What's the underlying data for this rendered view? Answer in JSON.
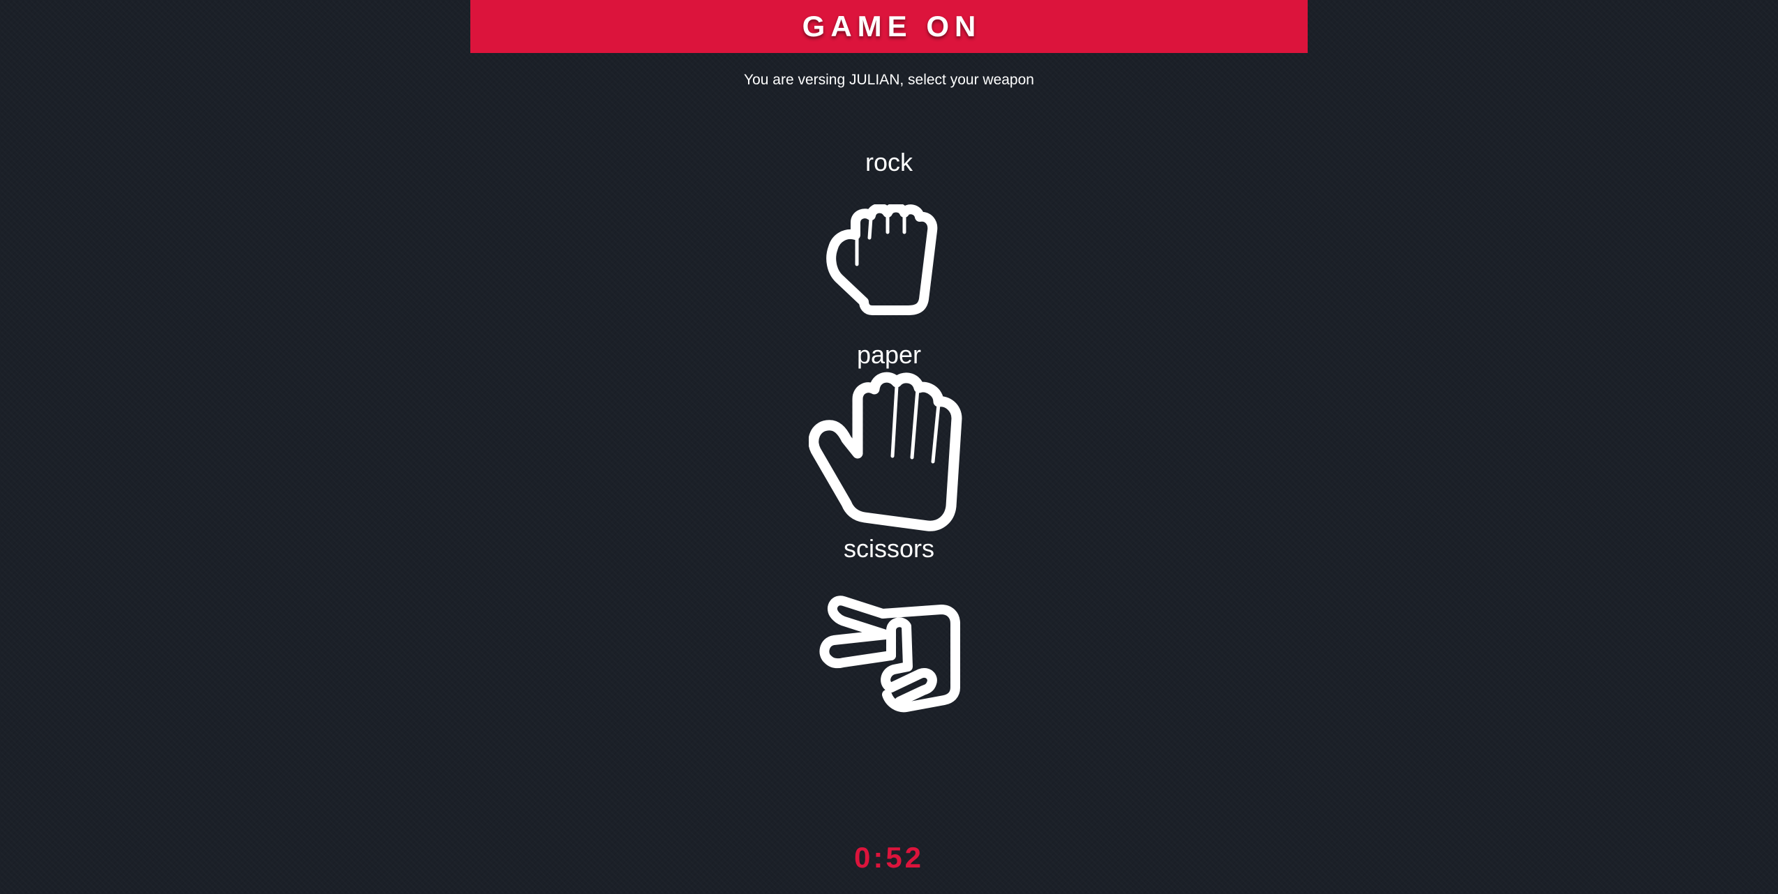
{
  "header": {
    "title": "GAME ON"
  },
  "prompt": {
    "text": "You are versing JULIAN, select your weapon"
  },
  "weapons": [
    {
      "label": "rock",
      "icon": "rock-fist-icon"
    },
    {
      "label": "paper",
      "icon": "paper-hand-icon"
    },
    {
      "label": "scissors",
      "icon": "scissors-hand-icon"
    }
  ],
  "timer": {
    "value": "0:52"
  },
  "colors": {
    "accent": "#dc143c",
    "background": "#1b2028",
    "text": "#ffffff"
  }
}
